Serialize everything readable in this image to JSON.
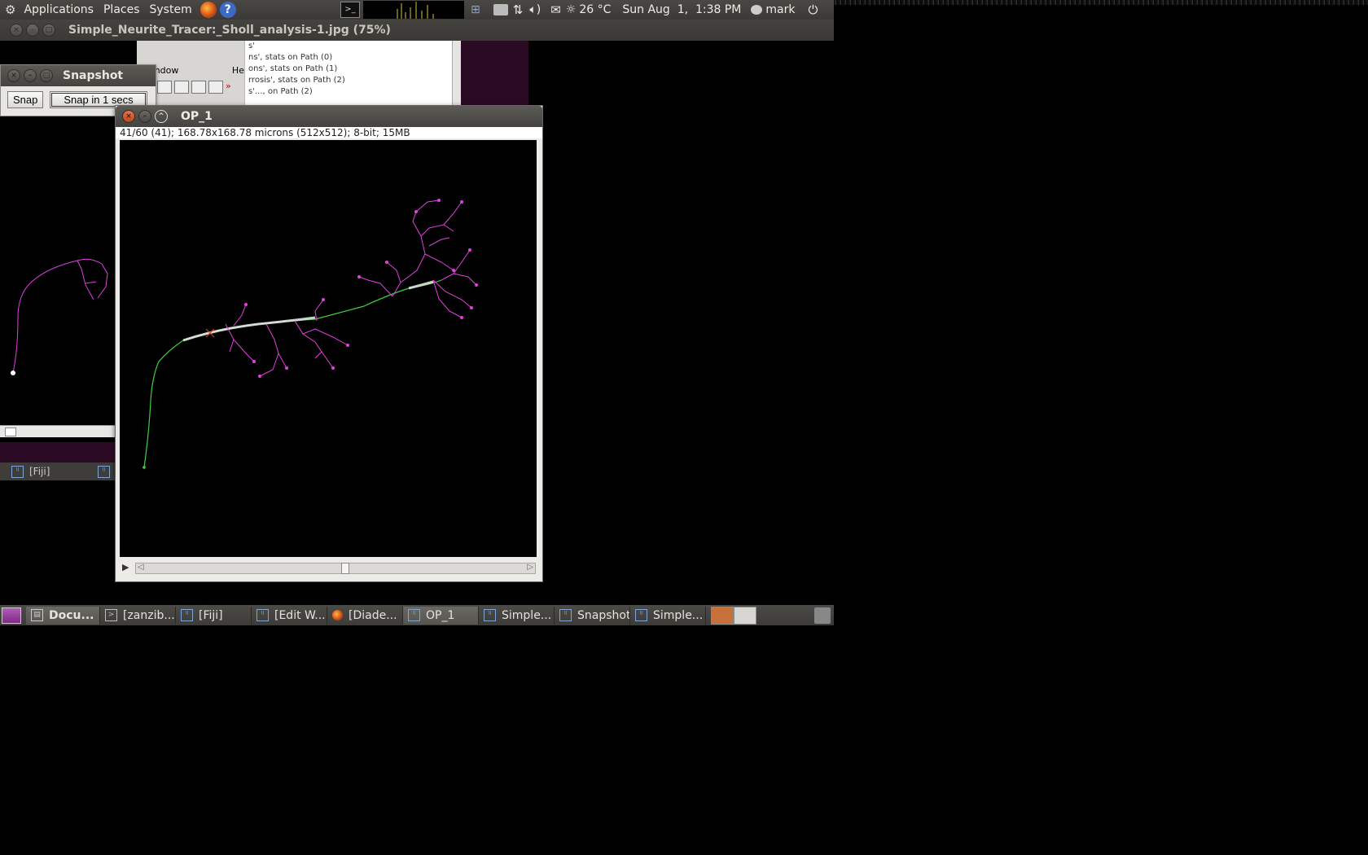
{
  "top_panel": {
    "menus": [
      "Applications",
      "Places",
      "System"
    ],
    "weather": "26 °C",
    "clock": "Sun Aug  1,  1:38 PM",
    "user": "mark"
  },
  "main_window": {
    "title": "Simple_Neurite_Tracer:_Sholl_analysis-1.jpg (75%)"
  },
  "fiji_window": {
    "menu_window": "Window",
    "menu_help": "Help"
  },
  "results_window": {
    "lines": [
      "s'",
      "ns', stats on Path (0)",
      "ons', stats on Path (1)",
      "rrosis', stats on Path (2)",
      "s'..., on Path (2)"
    ]
  },
  "snapshot_dialog": {
    "title": "Snapshot",
    "snap_label": "Snap",
    "snap_delay_label": "Snap in 1 secs"
  },
  "image_window": {
    "title": "OP_1",
    "info": "41/60 (41); 168.78x168.78 microns (512x512); 8-bit; 15MB",
    "slice_position": 0.52
  },
  "left_panel": {
    "taskbar_item": "[Fiji]"
  },
  "taskbar": {
    "items": [
      {
        "label": "Docu...",
        "icon": "printer-icon"
      },
      {
        "label": "[zanzib...",
        "icon": "terminal-icon"
      },
      {
        "label": "[Fiji]",
        "icon": "fiji-icon"
      },
      {
        "label": "[Edit W...",
        "icon": "fiji-icon"
      },
      {
        "label": "[Diade...",
        "icon": "firefox-icon"
      },
      {
        "label": "OP_1",
        "icon": "fiji-icon"
      },
      {
        "label": "Simple...",
        "icon": "fiji-icon"
      },
      {
        "label": "Snapshot",
        "icon": "fiji-icon"
      },
      {
        "label": "Simple...",
        "icon": "fiji-icon"
      }
    ]
  },
  "colors": {
    "trace_magenta": "#e040e0",
    "trace_green": "#3fd03f",
    "panel": "#3c3b37"
  }
}
